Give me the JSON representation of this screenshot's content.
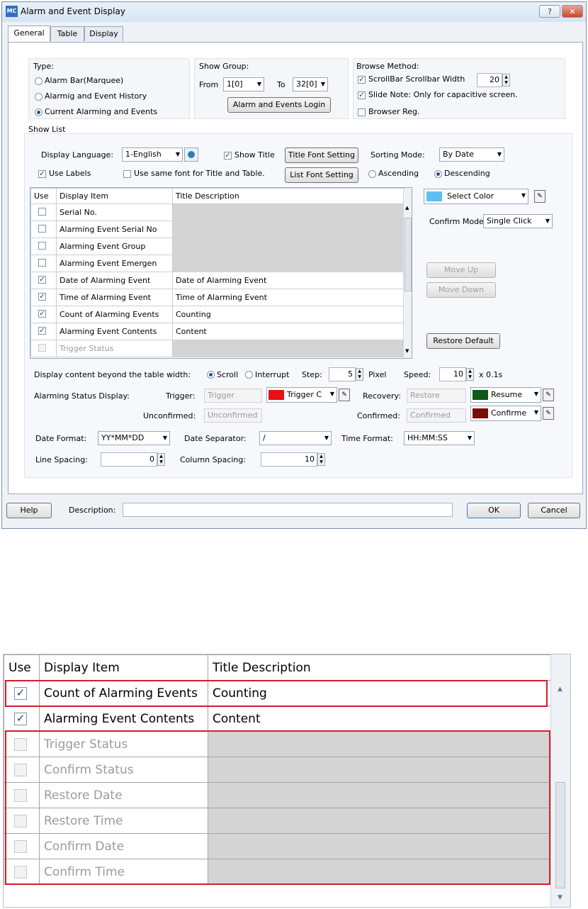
{
  "window": {
    "app_icon": "MC",
    "title": "Alarm and Event Display",
    "help_glyph": "?",
    "close_glyph": "✕",
    "tabs": [
      "General",
      "Table",
      "Display"
    ]
  },
  "type_group": {
    "title": "Type:",
    "options": [
      "Alarm Bar(Marquee)",
      "Alarmig and Event History",
      "Current Alarming and Events"
    ],
    "selected": "Current Alarming and Events"
  },
  "show_group": {
    "title": "Show Group:",
    "from_label": "From",
    "from_value": "1[0]",
    "to_label": "To",
    "to_value": "32[0]",
    "login_button": "Alarm and Events Login"
  },
  "browse": {
    "title": "Browse Method:",
    "scrollbar_label": "ScrollBar Scrollbar Width",
    "scrollbar_width": "20",
    "slide_note": "Slide Note: Only for capacitive screen.",
    "browser_reg": "Browser Reg."
  },
  "show_list": {
    "title": "Show List",
    "display_language_label": "Display Language:",
    "display_language": "1-English",
    "show_title": "Show Title",
    "title_font_button": "Title Font Setting",
    "sorting_mode_label": "Sorting Mode:",
    "sorting_mode": "By Date",
    "use_labels": "Use Labels",
    "same_font": "Use same font for Title and Table.",
    "list_font_button": "List Font Setting",
    "ascending": "Ascending",
    "descending": "Descending"
  },
  "table": {
    "headers": [
      "Use",
      "Display Item",
      "Title Description"
    ],
    "rows": [
      {
        "checked": false,
        "item": "Serial No.",
        "title": ""
      },
      {
        "checked": false,
        "item": "Alarming Event Serial No",
        "title": ""
      },
      {
        "checked": false,
        "item": "Alarming Event Group",
        "title": ""
      },
      {
        "checked": false,
        "item": "Alarming Event Emergen",
        "title": ""
      },
      {
        "checked": true,
        "item": "Date of Alarming Event",
        "title": "Date of Alarming Event"
      },
      {
        "checked": true,
        "item": "Time of Alarming Event",
        "title": "Time of Alarming Event"
      },
      {
        "checked": true,
        "item": "Count of Alarming Events",
        "title": "Counting"
      },
      {
        "checked": true,
        "item": "Alarming Event Contents",
        "title": "Content"
      },
      {
        "checked": false,
        "item": "Trigger Status",
        "title": ""
      }
    ]
  },
  "right_panel": {
    "select_color": "Select Color",
    "select_color_value": "#5fbff0",
    "confirm_mode_label": "Confirm Mode:",
    "confirm_mode": "Single Click",
    "move_up": "Move Up",
    "move_down": "Move Down",
    "restore_default": "Restore Default"
  },
  "beyond": {
    "label": "Display content beyond the table width:",
    "scroll": "Scroll",
    "interrupt": "Interrupt",
    "step_label": "Step:",
    "step": "5",
    "pixel": "Pixel",
    "speed_label": "Speed:",
    "speed": "10",
    "speed_unit": "x 0.1s"
  },
  "status": {
    "label": "Alarming Status Display:",
    "trigger_label": "Trigger:",
    "trigger_value": "Trigger",
    "trigger_color": "#e81010",
    "trigger_combo": "Trigger C",
    "recovery_label": "Recovery:",
    "recovery_value": "Restore",
    "recovery_color": "#0d5a16",
    "recovery_combo": "Resume",
    "unconfirmed_label": "Unconfirmed:",
    "unconfirmed_value": "Unconfirmed",
    "confirmed_label": "Confirmed:",
    "confirmed_value": "Confirmed",
    "confirmed_color": "#7a0b0b",
    "confirmed_combo": "Confirme"
  },
  "format": {
    "date_format_label": "Date Format:",
    "date_format": "YY*MM*DD",
    "date_sep_label": "Date Separator:",
    "date_sep": "/",
    "time_format_label": "Time Format:",
    "time_format": "HH:MM:SS",
    "line_spacing_label": "Line Spacing:",
    "line_spacing": "0",
    "column_spacing_label": "Column Spacing:",
    "column_spacing": "10"
  },
  "footer": {
    "help": "Help",
    "description_label": "Description:",
    "description_value": "",
    "ok": "OK",
    "cancel": "Cancel"
  },
  "zoom_table": {
    "headers": [
      "Use",
      "Display Item",
      "Title Description"
    ],
    "rows": [
      {
        "checked": true,
        "item": "Count of Alarming Events",
        "title": "Counting"
      },
      {
        "checked": true,
        "item": "Alarming Event Contents",
        "title": "Content"
      },
      {
        "checked": false,
        "item": "Trigger Status",
        "title": ""
      },
      {
        "checked": false,
        "item": "Confirm Status",
        "title": ""
      },
      {
        "checked": false,
        "item": "Restore Date",
        "title": ""
      },
      {
        "checked": false,
        "item": "Restore Time",
        "title": ""
      },
      {
        "checked": false,
        "item": "Confirm Date",
        "title": ""
      },
      {
        "checked": false,
        "item": "Confirm Time",
        "title": ""
      }
    ]
  }
}
